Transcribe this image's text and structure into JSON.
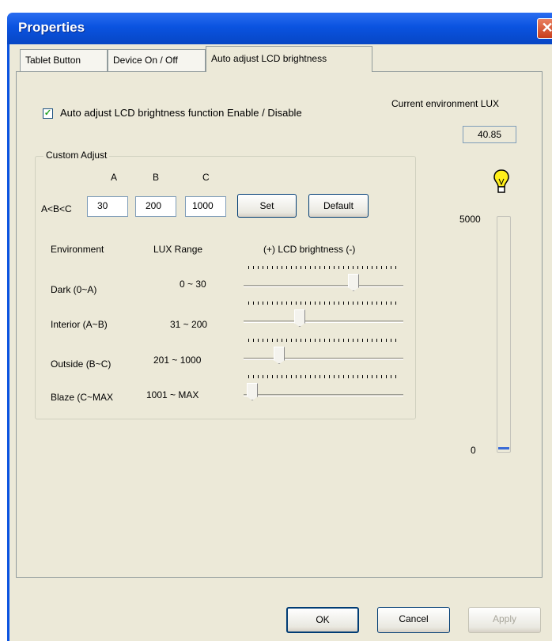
{
  "window": {
    "title": "Properties",
    "close_glyph": "✕",
    "colors": {
      "titlebar": "#0a53e0",
      "body": "#ece9d8",
      "close": "#c83e1c"
    }
  },
  "tabs": [
    {
      "label": "Tablet Button"
    },
    {
      "label": "Device On / Off"
    },
    {
      "label": "Auto adjust LCD brightness",
      "active": true
    }
  ],
  "auto_adjust": {
    "checkbox_checked": true,
    "checkbox_label": "Auto adjust LCD brightness function Enable / Disable"
  },
  "current_lux": {
    "title": "Current environment LUX",
    "value": "40.85"
  },
  "custom_adjust": {
    "title": "Custom Adjust",
    "columns": [
      "A",
      "B",
      "C"
    ],
    "label": "A<B<C",
    "values": [
      "30",
      "200",
      "1000"
    ],
    "set_label": "Set",
    "default_label": "Default"
  },
  "table": {
    "headers": [
      "Environment",
      "LUX Range",
      "(+) LCD brightness (-)"
    ],
    "rows": [
      {
        "environment": "Dark (0~A)",
        "range": "0 ~ 30",
        "slider_fraction": 0.7
      },
      {
        "environment": "Interior (A~B)",
        "range": "31 ~ 200",
        "slider_fraction": 0.34
      },
      {
        "environment": "Outside (B~C)",
        "range": "201 ~ 1000",
        "slider_fraction": 0.2
      },
      {
        "environment": "Blaze (C~MAX",
        "range": "1001 ~ MAX",
        "slider_fraction": 0.02
      }
    ]
  },
  "gauge": {
    "icon": "lightbulb-icon",
    "max_label": "5000",
    "min_label": "0",
    "max": 5000,
    "value": 40.85
  },
  "footer": {
    "ok_label": "OK",
    "cancel_label": "Cancel",
    "apply_label": "Apply"
  }
}
